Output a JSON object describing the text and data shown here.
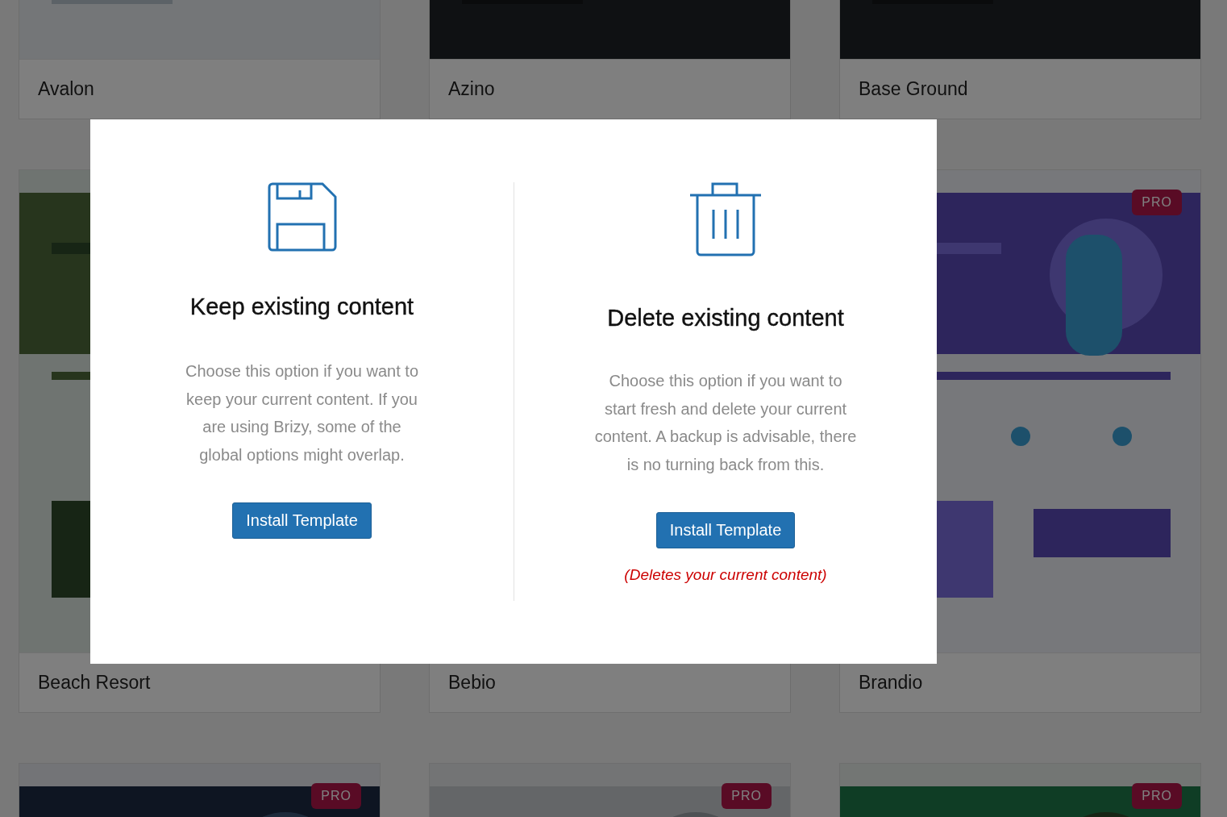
{
  "cards": [
    {
      "title": "Avalon"
    },
    {
      "title": "Azino"
    },
    {
      "title": "Base Ground"
    },
    {
      "title": "Beach Resort"
    },
    {
      "title": "Bebio"
    },
    {
      "title": "Brandio",
      "badge": "PRO"
    },
    {
      "badge": "PRO"
    },
    {
      "badge": "PRO"
    },
    {
      "badge": "PRO"
    }
  ],
  "modal": {
    "options": [
      {
        "kind": "keep",
        "heading": "Keep existing content",
        "text": "Choose this option if you want to keep your current content. If you are using Brizy, some of the global options might overlap.",
        "button": "Install Template"
      },
      {
        "kind": "delete",
        "heading": "Delete existing content",
        "text": "Choose this option if you want to start fresh and delete your current content. A backup is advisable, there is no turning back from this.",
        "button": "Install Template",
        "warning": "(Deletes your current content)"
      }
    ]
  }
}
